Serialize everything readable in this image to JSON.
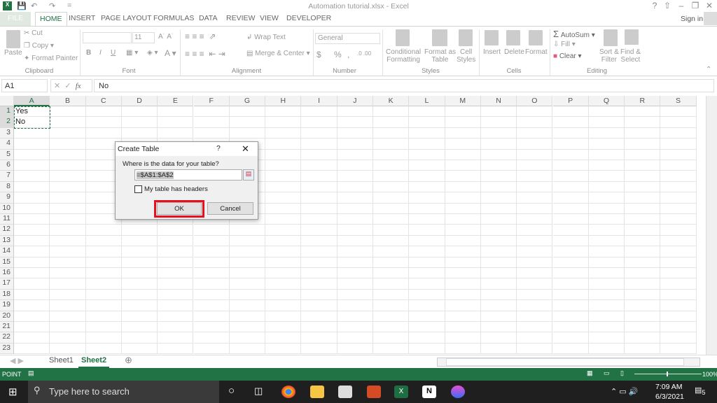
{
  "window": {
    "title": "Automation tutorial.xlsx - Excel",
    "help": "?",
    "sign_in": "Sign in"
  },
  "tabs": [
    "FILE",
    "HOME",
    "INSERT",
    "PAGE LAYOUT",
    "FORMULAS",
    "DATA",
    "REVIEW",
    "VIEW",
    "DEVELOPER"
  ],
  "active_tab": "HOME",
  "ribbon": {
    "clipboard": {
      "paste": "Paste",
      "cut": "Cut",
      "copy": "Copy",
      "format_painter": "Format Painter",
      "label": "Clipboard"
    },
    "font": {
      "size": "11",
      "bold": "B",
      "italic": "I",
      "underline": "U",
      "label": "Font"
    },
    "alignment": {
      "wrap": "Wrap Text",
      "merge": "Merge & Center",
      "label": "Alignment"
    },
    "number": {
      "format": "General",
      "currency": "$",
      "percent": "%",
      "comma": ",",
      "label": "Number"
    },
    "styles": {
      "conditional": "Conditional",
      "conditional2": "Formatting",
      "format_table": "Format as",
      "format_table2": "Table",
      "cell_styles": "Cell",
      "cell_styles2": "Styles",
      "label": "Styles"
    },
    "cells": {
      "insert": "Insert",
      "delete": "Delete",
      "format": "Format",
      "label": "Cells"
    },
    "editing": {
      "autosum": "AutoSum",
      "fill": "Fill",
      "clear": "Clear",
      "sort": "Sort &",
      "sort2": "Filter",
      "find": "Find &",
      "find2": "Select",
      "label": "Editing"
    }
  },
  "formula_bar": {
    "name_box": "A1",
    "fx": "fx",
    "value": "No"
  },
  "columns": [
    "A",
    "B",
    "C",
    "D",
    "E",
    "F",
    "G",
    "H",
    "I",
    "J",
    "K",
    "L",
    "M",
    "N",
    "O",
    "P",
    "Q",
    "R",
    "S"
  ],
  "rows": [
    "1",
    "2",
    "3",
    "4",
    "5",
    "6",
    "7",
    "8",
    "9",
    "10",
    "11",
    "12",
    "13",
    "14",
    "15",
    "16",
    "17",
    "18",
    "19",
    "20",
    "21",
    "22",
    "23"
  ],
  "cells": {
    "A1": "Yes",
    "A2": "No"
  },
  "sheets": [
    "Sheet1",
    "Sheet2"
  ],
  "active_sheet": "Sheet2",
  "status": {
    "mode": "POINT",
    "zoom": "100%"
  },
  "dialog": {
    "title": "Create Table",
    "help": "?",
    "prompt": "Where is the data for your table?",
    "range": "=$A$1:$A$2",
    "headers_label": "My table has headers",
    "headers_checked": false,
    "ok": "OK",
    "cancel": "Cancel",
    "highlight_color": "#e8101e"
  },
  "taskbar": {
    "search_placeholder": "Type here to search",
    "time": "7:09 AM",
    "date": "6/3/2021",
    "notifications": "5"
  },
  "colors": {
    "excel_green": "#217346",
    "taskbar": "#1f1f1f"
  }
}
